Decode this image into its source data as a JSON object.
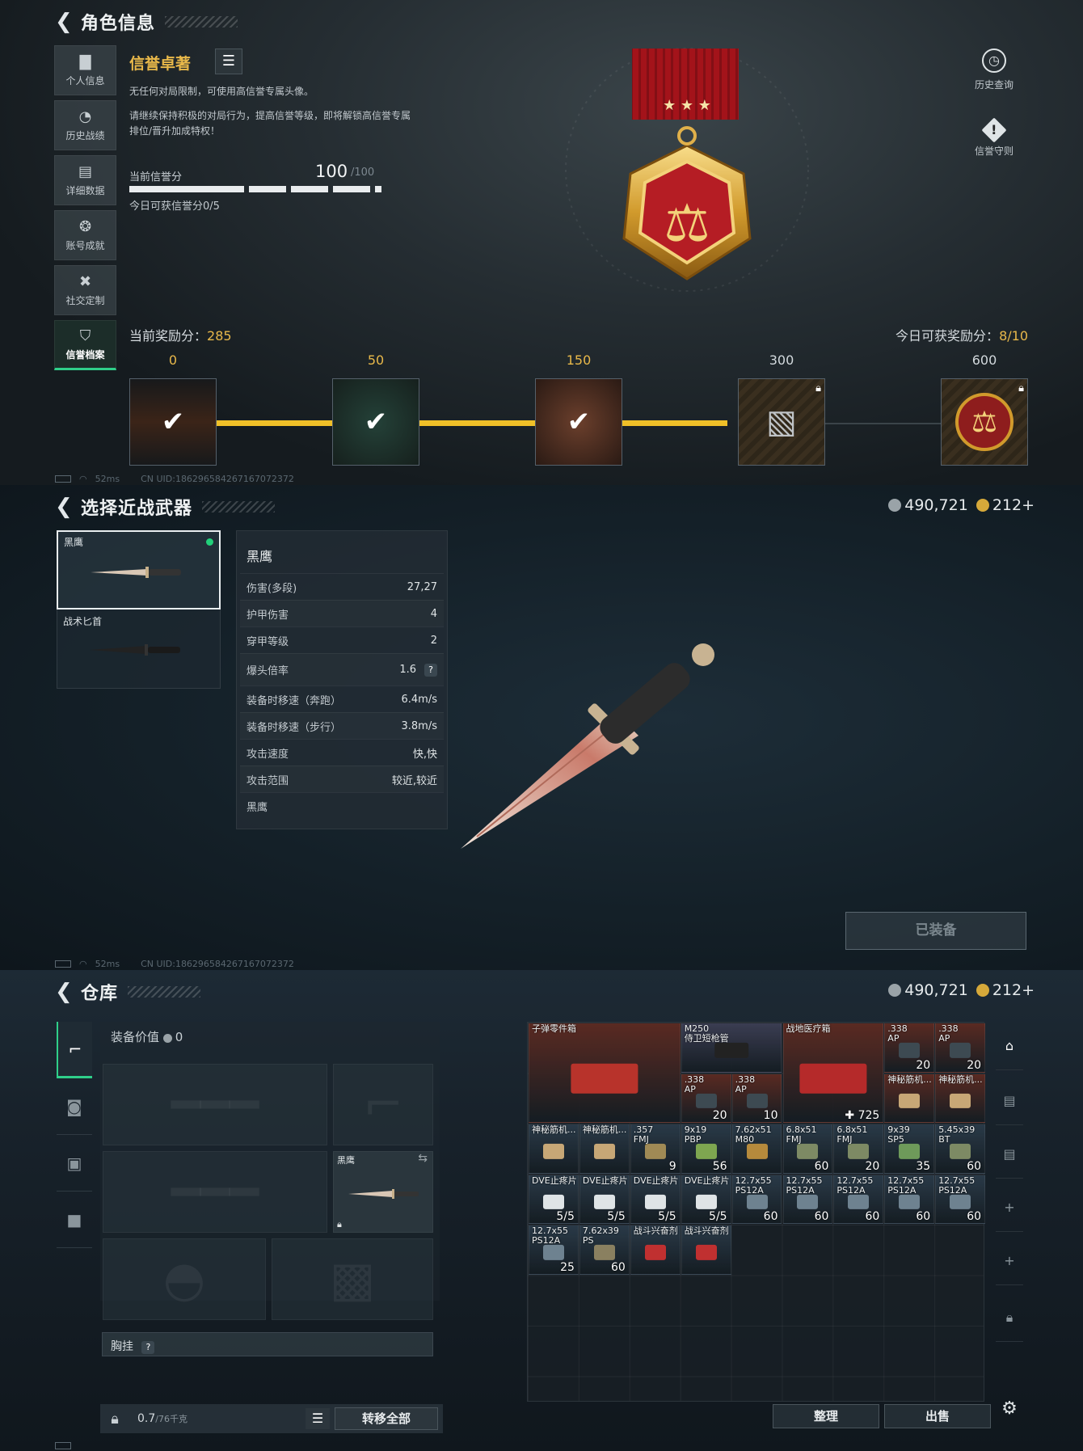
{
  "panel1": {
    "title": "角色信息",
    "nav": [
      {
        "label": "个人信息",
        "icon": "bar-chart-icon"
      },
      {
        "label": "历史战绩",
        "icon": "clock-icon"
      },
      {
        "label": "详细数据",
        "icon": "folder-icon"
      },
      {
        "label": "账号成就",
        "icon": "badge-icon"
      },
      {
        "label": "社交定制",
        "icon": "tools-icon"
      },
      {
        "label": "信誉档案",
        "icon": "shield-icon",
        "active": true
      }
    ],
    "reputation_title": "信誉卓著",
    "desc1": "无任何对局限制，可使用高信誉专属头像。",
    "desc2": "请继续保持积极的对局行为，提高信誉等级，即将解锁高信誉专属",
    "desc3": "排位/晋升加成特权！",
    "score_label": "当前信誉分",
    "score_value": "100",
    "score_max": "/100",
    "score_today": "今日可获信誉分0/5",
    "right_buttons": [
      {
        "label": "历史查询",
        "icon": "history-icon"
      },
      {
        "label": "信誉守则",
        "icon": "rules-icon"
      }
    ],
    "current_reward_label": "当前奖励分：",
    "current_reward_value": "285",
    "today_reward_label": "今日可获奖励分：",
    "today_reward_value": "8/10",
    "tiers": [
      {
        "value": "0",
        "claimed": true,
        "locked": false
      },
      {
        "value": "50",
        "claimed": true,
        "locked": false
      },
      {
        "value": "150",
        "claimed": true,
        "locked": false
      },
      {
        "value": "300",
        "claimed": false,
        "locked": true
      },
      {
        "value": "600",
        "claimed": false,
        "locked": true
      }
    ],
    "status_ping": "52ms",
    "status_uid": "CN UID:18629658426716707237​2"
  },
  "panel2": {
    "title": "选择近战武器",
    "currency1": "490,721",
    "currency2": "212+",
    "weapons": [
      {
        "name": "黑鹰",
        "equipped": true
      },
      {
        "name": "战术匕首",
        "equipped": false
      }
    ],
    "stats_title": "黑鹰",
    "stats": [
      {
        "k": "伤害(多段)",
        "v": "27,27"
      },
      {
        "k": "护甲伤害",
        "v": "4"
      },
      {
        "k": "穿甲等级",
        "v": "2"
      },
      {
        "k": "爆头倍率",
        "v": "1.6",
        "help": "?"
      },
      {
        "k": "装备时移速（奔跑）",
        "v": "6.4m/s"
      },
      {
        "k": "装备时移速（步行）",
        "v": "3.8m/s"
      },
      {
        "k": "攻击速度",
        "v": "快,快"
      },
      {
        "k": "攻击范围",
        "v": "较近,较近"
      },
      {
        "k": "黑鹰",
        "v": ""
      }
    ],
    "equip_button": "已装备",
    "status_ping": "52ms",
    "status_uid": "CN UID:186296584267167072372"
  },
  "panel3": {
    "title": "仓库",
    "currency1": "490,721",
    "currency2": "212+",
    "equip_value_label": "装备价值",
    "equip_value": "0",
    "melee_slot_name": "黑鹰",
    "chest_label": "胸挂",
    "chest_help": "?",
    "weight": "0.7",
    "weight_max": "/76千克",
    "transfer_all": "转移全部",
    "sort_button": "整理",
    "sell_button": "出售",
    "items": [
      {
        "name": "子弹零件箱",
        "count": ""
      },
      {
        "name": "M250\n侍卫短枪管",
        "count": ""
      },
      {
        "name": "战地医疗箱",
        "count": "725"
      },
      {
        "name": ".338\nAP",
        "count": "20"
      },
      {
        "name": ".338\nAP",
        "count": "20"
      },
      {
        "name": ".338\nAP",
        "count": "20"
      },
      {
        "name": ".338\nAP",
        "count": "10"
      },
      {
        "name": "神秘筋机...",
        "count": ""
      },
      {
        "name": "神秘筋机...",
        "count": ""
      },
      {
        "name": "神秘筋机...",
        "count": ""
      },
      {
        "name": "神秘筋机...",
        "count": ""
      },
      {
        "name": ".357\nFMJ",
        "count": "9"
      },
      {
        "name": "9x19\nPBP",
        "count": "56"
      },
      {
        "name": "7.62x51\nM80",
        "count": ""
      },
      {
        "name": "6.8x51\nFMJ",
        "count": "60"
      },
      {
        "name": "6.8x51\nFMJ",
        "count": "20"
      },
      {
        "name": "9x39\nSP5",
        "count": "35"
      },
      {
        "name": "5.45x39\nBT",
        "count": "60"
      },
      {
        "name": "DVE止疼片",
        "count": "5/5"
      },
      {
        "name": "DVE止疼片",
        "count": "5/5"
      },
      {
        "name": "DVE止疼片",
        "count": "5/5"
      },
      {
        "name": "DVE止疼片",
        "count": "5/5"
      },
      {
        "name": "12.7x55\nPS12A",
        "count": "60"
      },
      {
        "name": "12.7x55\nPS12A",
        "count": "60"
      },
      {
        "name": "12.7x55\nPS12A",
        "count": "60"
      },
      {
        "name": "12.7x55\nPS12A",
        "count": "60"
      },
      {
        "name": "12.7x55\nPS12A",
        "count": "60"
      },
      {
        "name": "12.7x55\nPS12A",
        "count": "25"
      },
      {
        "name": "7.62x39\nPS",
        "count": "60"
      },
      {
        "name": "战斗兴奋剂",
        "count": ""
      },
      {
        "name": "战斗兴奋剂",
        "count": ""
      }
    ]
  },
  "colors": {
    "accent_green": "#2fcf8a",
    "gold": "#e8b84a",
    "track_yellow": "#f0c028"
  }
}
